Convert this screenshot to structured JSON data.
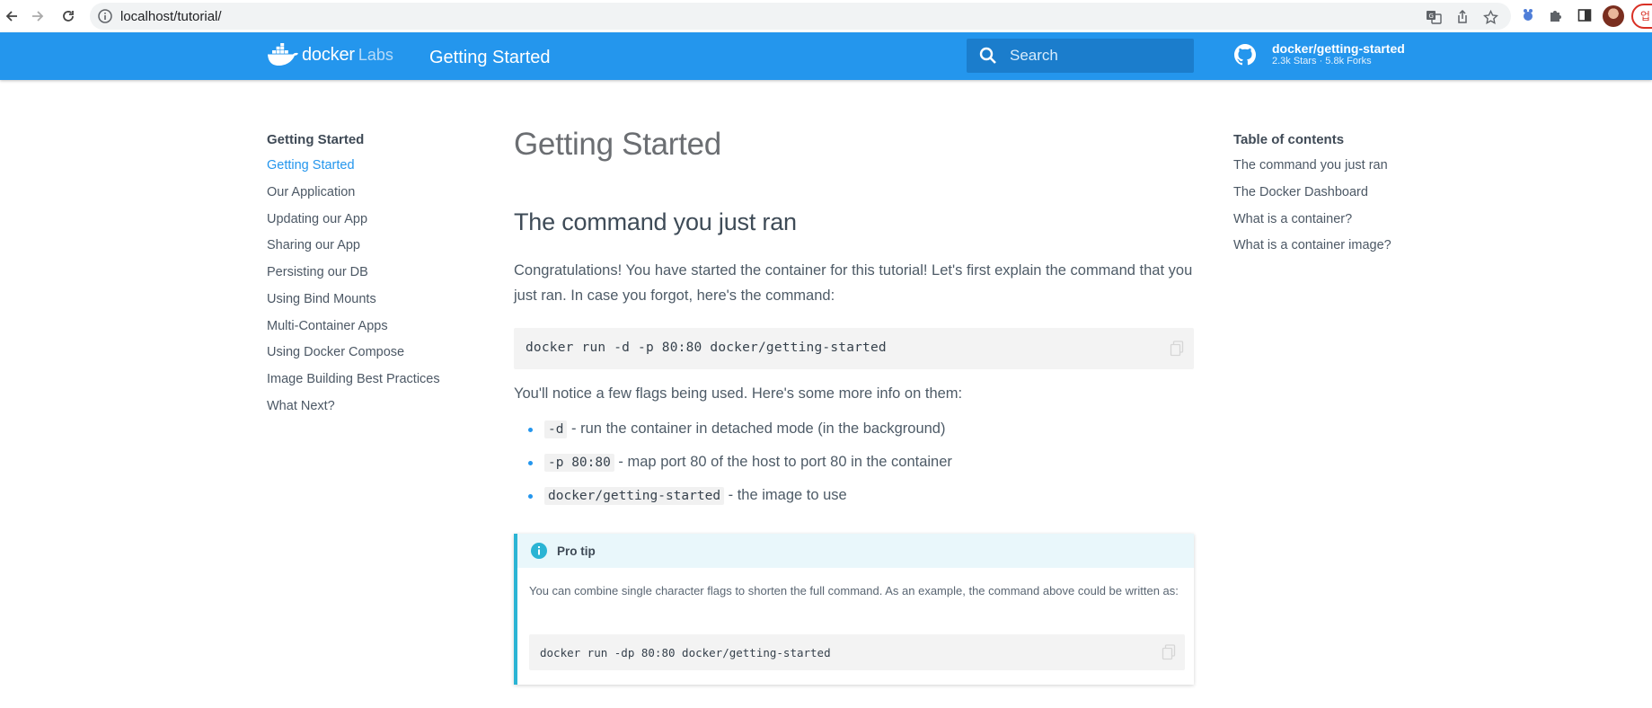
{
  "browser": {
    "url": "localhost/tutorial/",
    "update_label": "업"
  },
  "header": {
    "logo_text": "docker",
    "logo_labs": "Labs",
    "site_title": "Getting Started",
    "search_placeholder": "Search",
    "repo_name": "docker/getting-started",
    "repo_facts": "2.3k Stars · 5.8k Forks",
    "brand_color": "#2496ed"
  },
  "leftnav": {
    "heading": "Getting Started",
    "items": [
      {
        "label": "Getting Started",
        "active": true
      },
      {
        "label": "Our Application"
      },
      {
        "label": "Updating our App"
      },
      {
        "label": "Sharing our App"
      },
      {
        "label": "Persisting our DB"
      },
      {
        "label": "Using Bind Mounts"
      },
      {
        "label": "Multi-Container Apps"
      },
      {
        "label": "Using Docker Compose"
      },
      {
        "label": "Image Building Best Practices"
      },
      {
        "label": "What Next?"
      }
    ]
  },
  "main": {
    "title": "Getting Started",
    "section_title": "The command you just ran",
    "intro": "Congratulations! You have started the container for this tutorial! Let's first explain the command that you just ran. In case you forgot, here's the command:",
    "command": "docker run -d -p 80:80 docker/getting-started",
    "flags_intro": "You'll notice a few flags being used. Here's some more info on them:",
    "flags": [
      {
        "code": "-d",
        "desc": " - run the container in detached mode (in the background)"
      },
      {
        "code": "-p 80:80",
        "desc": " - map port 80 of the host to port 80 in the container"
      },
      {
        "code": "docker/getting-started",
        "desc": " - the image to use"
      }
    ],
    "tip": {
      "title": "Pro tip",
      "body": "You can combine single character flags to shorten the full command. As an example, the command above could be written as:",
      "command": "docker run -dp 80:80 docker/getting-started"
    }
  },
  "toc": {
    "heading": "Table of contents",
    "items": [
      "The command you just ran",
      "The Docker Dashboard",
      "What is a container?",
      "What is a container image?"
    ]
  }
}
